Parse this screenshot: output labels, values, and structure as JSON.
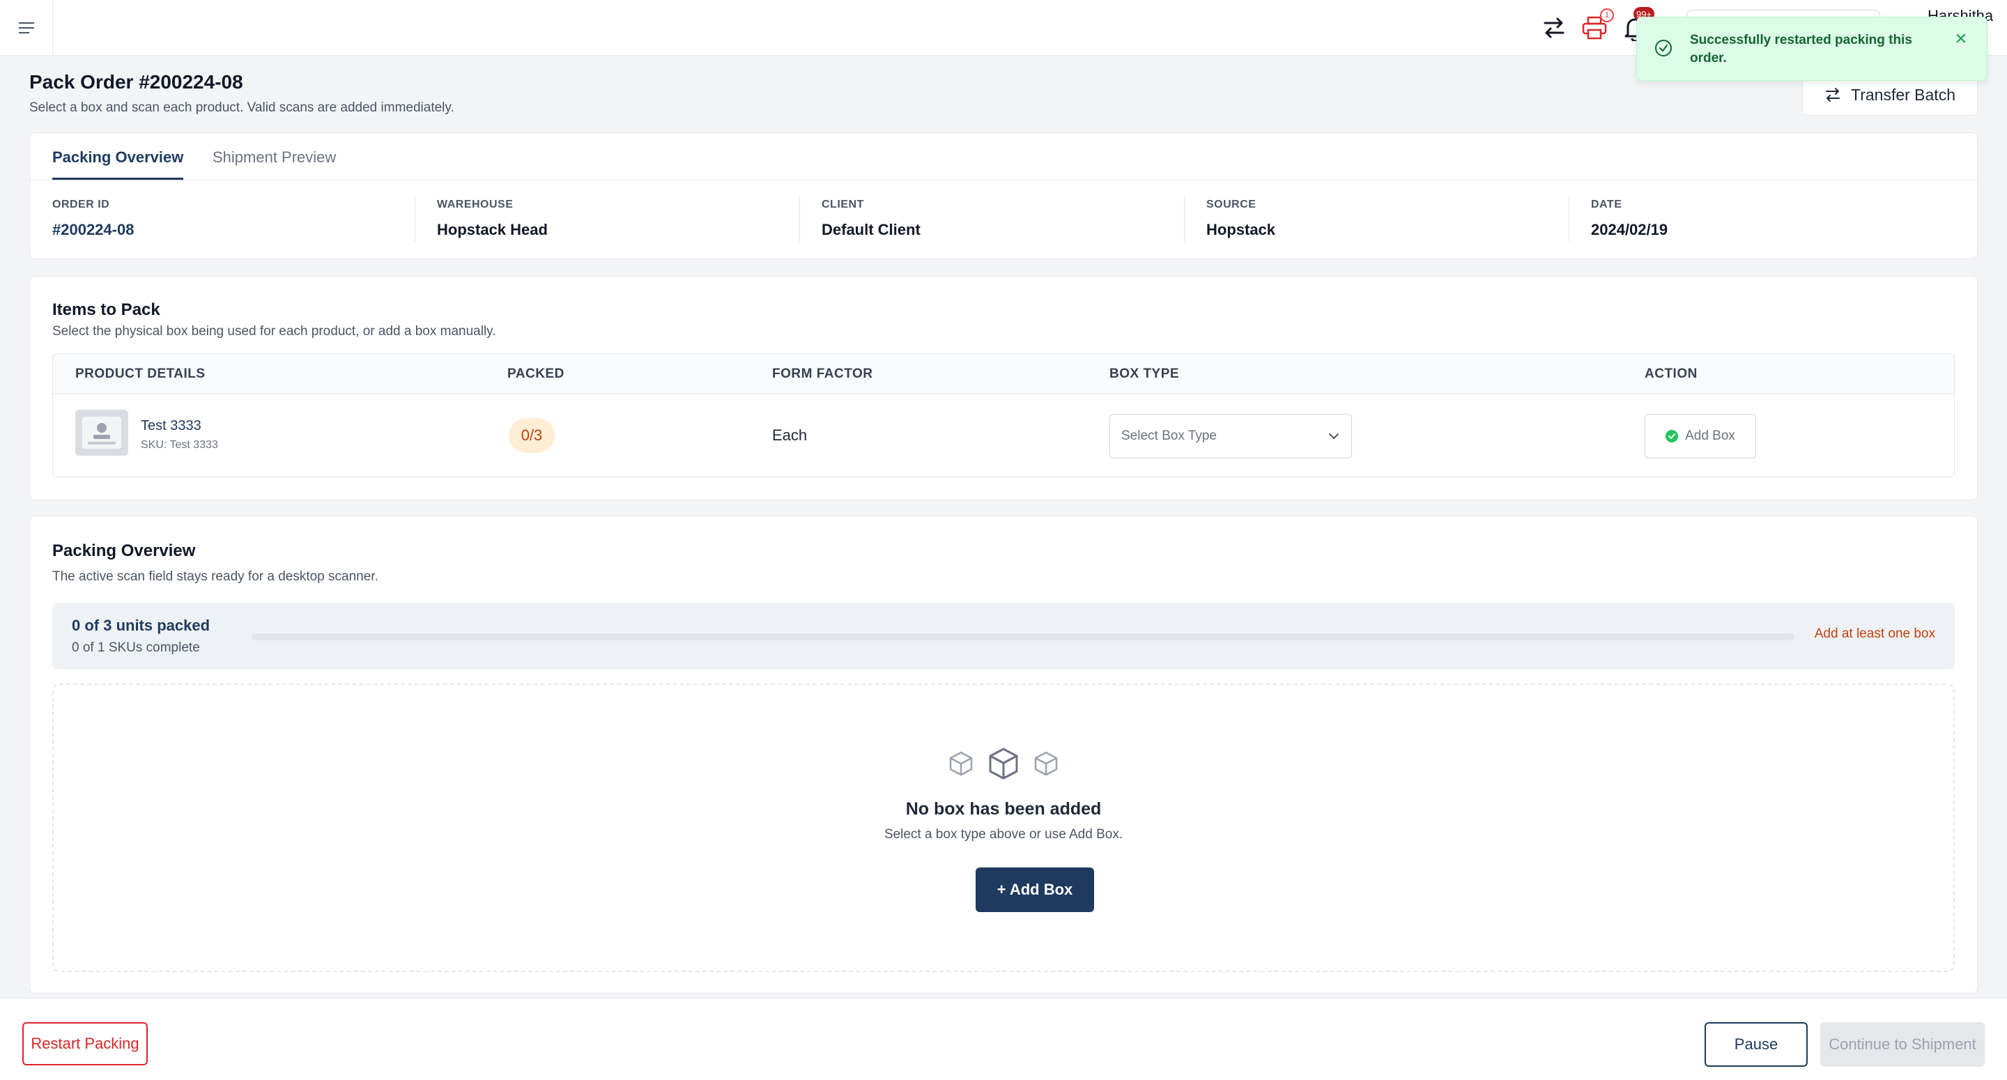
{
  "topbar": {
    "user_name": "Harshitha",
    "notifications_badge": "99+",
    "printer_badge": "1"
  },
  "toast": {
    "message": "Successfully restarted packing this order.",
    "close_glyph": "✕"
  },
  "header": {
    "title": "Pack Order #200224-08",
    "subtitle": "Select a box and scan each product. Valid scans are added immediately.",
    "transfer_label": "Transfer Batch"
  },
  "tabs": [
    {
      "label": "Packing Overview",
      "active": true
    },
    {
      "label": "Shipment Preview",
      "active": false
    }
  ],
  "order_info": [
    {
      "label": "ORDER ID",
      "value": "#200224-08"
    },
    {
      "label": "WAREHOUSE",
      "value": "Hopstack Head"
    },
    {
      "label": "CLIENT",
      "value": "Default Client"
    },
    {
      "label": "SOURCE",
      "value": "Hopstack"
    },
    {
      "label": "DATE",
      "value": "2024/02/19"
    }
  ],
  "items_section": {
    "title": "Items to Pack",
    "subtitle": "Select the physical box being used for each product, or add a box manually.",
    "columns": [
      "PRODUCT DETAILS",
      "PACKED",
      "FORM FACTOR",
      "BOX TYPE",
      "ACTION"
    ],
    "rows": [
      {
        "name": "Test 3333",
        "sku": "SKU: Test 3333",
        "packed": "0/3",
        "form_factor": "Each",
        "box_type_placeholder": "Select Box Type",
        "action_label": "Add Box"
      }
    ]
  },
  "packing_section": {
    "title": "Packing Overview",
    "subtitle": "The active scan field stays ready for a desktop scanner.",
    "units_packed": "0 of 3 units packed",
    "skus_complete": "0 of 1 SKUs complete",
    "progress_fraction": 0,
    "hint": "Add at least one box",
    "empty_title": "No box has been added",
    "empty_subtitle": "Select a box type above or use Add Box.",
    "add_box_label": "+ Add Box"
  },
  "footer": {
    "restart_label": "Restart Packing",
    "pause_label": "Pause",
    "continue_label": "Continue to Shipment"
  },
  "colors": {
    "primary": "#1e3a5f",
    "danger": "#dc2626",
    "success_bg": "#dcfce7",
    "warning": "#c2410c"
  },
  "icons": [
    "hamburger-menu-icon",
    "transfer-arrows-icon",
    "printer-icon",
    "bell-icon",
    "check-circle-icon",
    "close-icon",
    "chevron-down-icon",
    "box-icon"
  ]
}
